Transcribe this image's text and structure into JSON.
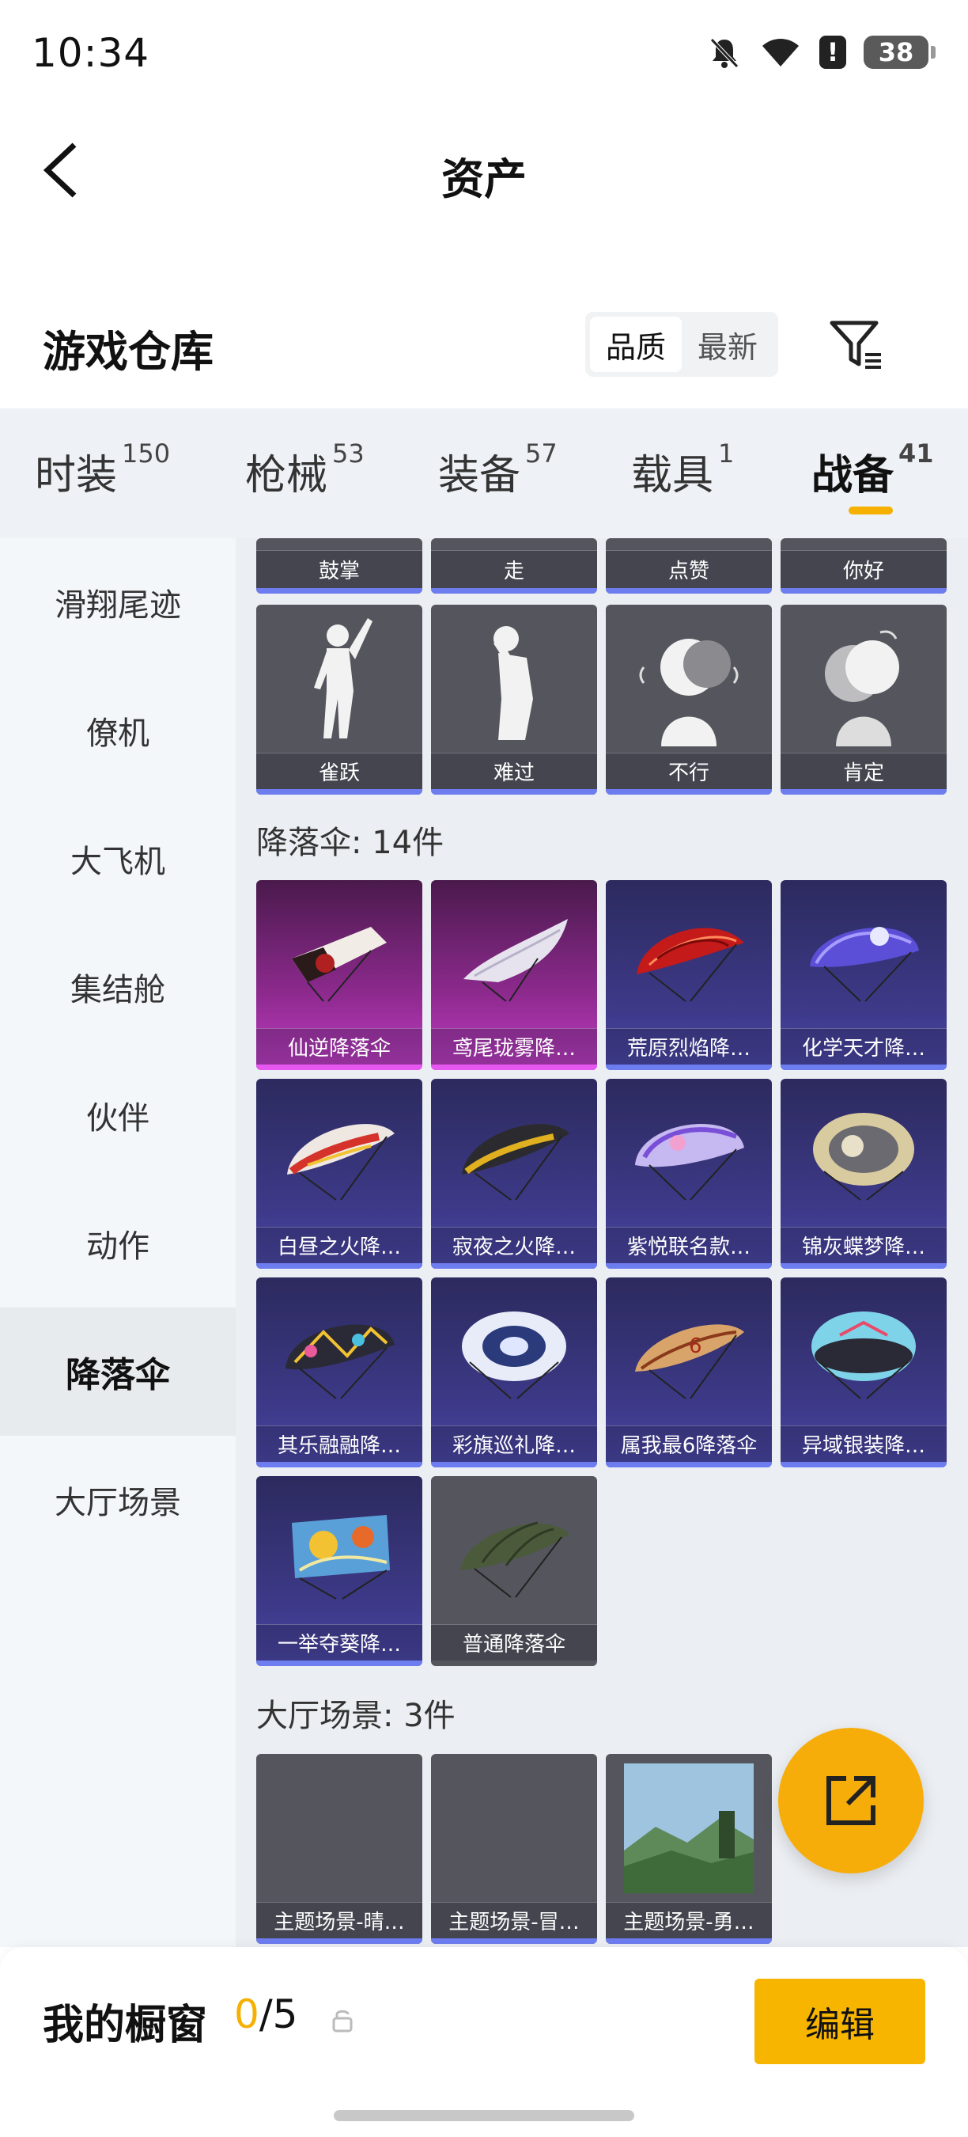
{
  "status_bar": {
    "time": "10:34",
    "battery": "38"
  },
  "header": {
    "title": "资产"
  },
  "warehouse": {
    "title": "游戏仓库",
    "sort_options": [
      "品质",
      "最新"
    ],
    "sort_active": "品质"
  },
  "tabs": [
    {
      "label": "时装",
      "count": "150"
    },
    {
      "label": "枪械",
      "count": "53"
    },
    {
      "label": "装备",
      "count": "57"
    },
    {
      "label": "载具",
      "count": "1"
    },
    {
      "label": "战备",
      "count": "41",
      "active": true
    }
  ],
  "sidebar": {
    "items": [
      "滑翔尾迹",
      "僚机",
      "大飞机",
      "集结舱",
      "伙伴",
      "动作",
      "降落伞",
      "大厅场景"
    ],
    "active": "降落伞"
  },
  "content": {
    "emotes_partial": [
      "鼓掌",
      "走",
      "点赞",
      "你好"
    ],
    "emotes": [
      "雀跃",
      "难过",
      "不行",
      "肯定"
    ],
    "parachute_section": "降落伞: 14件",
    "parachutes": [
      {
        "name": "仙逆降落伞",
        "rarity": "pink"
      },
      {
        "name": "鸢尾珑雾降…",
        "rarity": "pink"
      },
      {
        "name": "荒原烈焰降…",
        "rarity": "purple"
      },
      {
        "name": "化学天才降…",
        "rarity": "purple"
      },
      {
        "name": "白昼之火降…",
        "rarity": "purple"
      },
      {
        "name": "寂夜之火降…",
        "rarity": "purple"
      },
      {
        "name": "紫悦联名款…",
        "rarity": "purple"
      },
      {
        "name": "锦灰蝶梦降…",
        "rarity": "purple"
      },
      {
        "name": "其乐融融降…",
        "rarity": "purple"
      },
      {
        "name": "彩旗巡礼降…",
        "rarity": "purple"
      },
      {
        "name": "属我最6降落伞",
        "rarity": "purple"
      },
      {
        "name": "异域银装降…",
        "rarity": "purple"
      },
      {
        "name": "一举夺葵降…",
        "rarity": "purple"
      },
      {
        "name": "普通降落伞",
        "rarity": "gray"
      }
    ],
    "lobby_section": "大厅场景: 3件",
    "lobby_scenes": [
      "主题场景-晴…",
      "主题场景-冒…",
      "主题场景-勇…"
    ]
  },
  "showcase": {
    "title": "我的橱窗",
    "current": "0",
    "total": "/5",
    "edit_label": "编辑"
  },
  "colors": {
    "accent": "#f5b000",
    "rarity_pink": "#e657f0",
    "rarity_purple": "#6d7df0"
  }
}
